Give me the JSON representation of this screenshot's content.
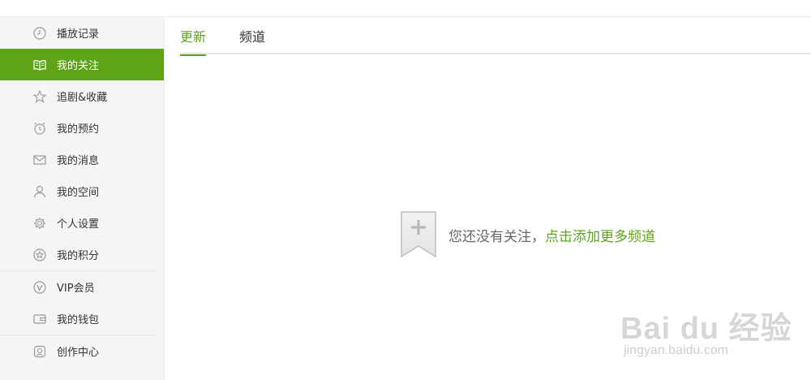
{
  "colors": {
    "accent": "#5fa417",
    "sidebar_bg": "#f5f5f5",
    "text": "#333333",
    "muted": "#666666"
  },
  "sidebar": {
    "groups": [
      {
        "items": [
          {
            "label": "播放记录",
            "icon": "clock-icon",
            "active": false
          },
          {
            "label": "我的关注",
            "icon": "open-book-icon",
            "active": true
          },
          {
            "label": "追剧&收藏",
            "icon": "star-icon",
            "active": false
          },
          {
            "label": "我的预约",
            "icon": "alarm-clock-icon",
            "active": false
          },
          {
            "label": "我的消息",
            "icon": "envelope-icon",
            "active": false
          },
          {
            "label": "我的空间",
            "icon": "person-icon",
            "active": false
          },
          {
            "label": "个人设置",
            "icon": "gear-icon",
            "active": false
          },
          {
            "label": "我的积分",
            "icon": "star-circle-icon",
            "active": false
          }
        ]
      },
      {
        "items": [
          {
            "label": "VIP会员",
            "icon": "vip-icon",
            "active": false
          },
          {
            "label": "我的钱包",
            "icon": "wallet-icon",
            "active": false
          }
        ]
      },
      {
        "items": [
          {
            "label": "创作中心",
            "icon": "creator-icon",
            "active": false
          }
        ]
      }
    ]
  },
  "tabs": [
    {
      "label": "更新",
      "active": true
    },
    {
      "label": "频道",
      "active": false
    }
  ],
  "empty_state": {
    "icon": "bookmark-plus-icon",
    "message": "您还没有关注，",
    "link": "点击添加更多频道"
  },
  "watermark": {
    "brand": "Bai du 经验",
    "url": "jingyan.baidu.com"
  }
}
